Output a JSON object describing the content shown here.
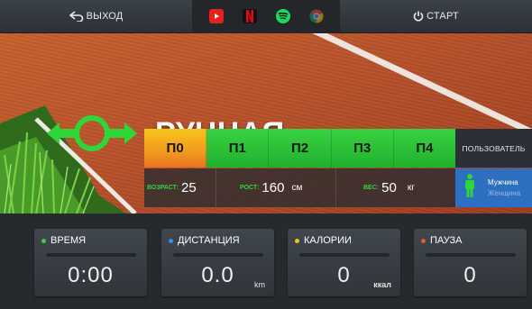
{
  "topbar": {
    "exit_label": "ВЫХОД",
    "start_label": "СТАРТ",
    "apps": [
      {
        "name": "youtube-icon",
        "color": "#e62117"
      },
      {
        "name": "netflix-icon",
        "color": "#e50914"
      },
      {
        "name": "spotify-icon",
        "color": "#1ed760"
      },
      {
        "name": "chrome-icon",
        "color": "#9aa0a6"
      }
    ]
  },
  "mode": {
    "title": "РУЧНАЯ",
    "icon": "expand-arrows-icon",
    "accent": "#2ed63a"
  },
  "programs": {
    "tabs": [
      "П0",
      "П1",
      "П2",
      "П3",
      "П4"
    ],
    "active_index": 0,
    "user_label": "ПОЛЬЗОВАТЕЛЬ"
  },
  "profile": {
    "age_label": "ВОЗРАСТ:",
    "age_value": "25",
    "height_label": "РОСТ:",
    "height_value": "160",
    "height_unit": "см",
    "weight_label": "ВЕС:",
    "weight_value": "50",
    "weight_unit": "кг",
    "gender_options": [
      "Мужчина",
      "Женщина"
    ],
    "gender_selected": "Мужчина"
  },
  "metrics": [
    {
      "title": "ВРЕМЯ",
      "value": "0:00",
      "unit": "",
      "dot_color": "#33d43f"
    },
    {
      "title": "ДИСТАНЦИЯ",
      "value": "0.0",
      "unit": "km",
      "dot_color": "#2f8fe0"
    },
    {
      "title": "КАЛОРИИ",
      "value": "0",
      "unit": "ккал",
      "dot_color": "#f4c419"
    },
    {
      "title": "ПАУЗА",
      "value": "0",
      "unit": "",
      "dot_color": "#e8562f"
    }
  ]
}
